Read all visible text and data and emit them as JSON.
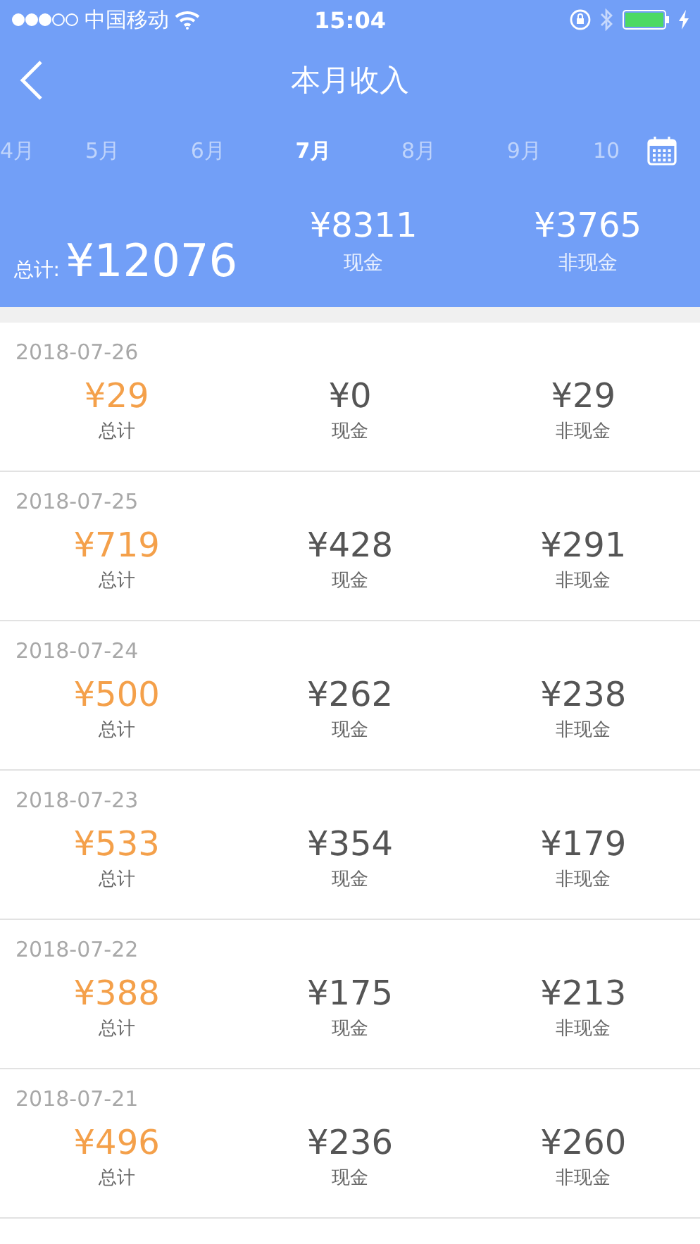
{
  "status_bar": {
    "carrier": "中国移动",
    "time": "15:04"
  },
  "nav": {
    "title": "本月收入"
  },
  "months": [
    {
      "label": "4月",
      "selected": false
    },
    {
      "label": "5月",
      "selected": false
    },
    {
      "label": "6月",
      "selected": false
    },
    {
      "label": "7月",
      "selected": true
    },
    {
      "label": "8月",
      "selected": false
    },
    {
      "label": "9月",
      "selected": false
    },
    {
      "label": "10",
      "selected": false
    }
  ],
  "summary": {
    "total_label": "总计:",
    "total": "¥12076",
    "cash": "¥8311",
    "cash_label": "现金",
    "noncash": "¥3765",
    "noncash_label": "非现金"
  },
  "days": [
    {
      "date": "2018-07-26",
      "total": "¥29",
      "total_label": "总计",
      "cash": "¥0",
      "cash_label": "现金",
      "noncash": "¥29",
      "noncash_label": "非现金"
    },
    {
      "date": "2018-07-25",
      "total": "¥719",
      "total_label": "总计",
      "cash": "¥428",
      "cash_label": "现金",
      "noncash": "¥291",
      "noncash_label": "非现金"
    },
    {
      "date": "2018-07-24",
      "total": "¥500",
      "total_label": "总计",
      "cash": "¥262",
      "cash_label": "现金",
      "noncash": "¥238",
      "noncash_label": "非现金"
    },
    {
      "date": "2018-07-23",
      "total": "¥533",
      "total_label": "总计",
      "cash": "¥354",
      "cash_label": "现金",
      "noncash": "¥179",
      "noncash_label": "非现金"
    },
    {
      "date": "2018-07-22",
      "total": "¥388",
      "total_label": "总计",
      "cash": "¥175",
      "cash_label": "现金",
      "noncash": "¥213",
      "noncash_label": "非现金"
    },
    {
      "date": "2018-07-21",
      "total": "¥496",
      "total_label": "总计",
      "cash": "¥236",
      "cash_label": "现金",
      "noncash": "¥260",
      "noncash_label": "非现金"
    }
  ]
}
